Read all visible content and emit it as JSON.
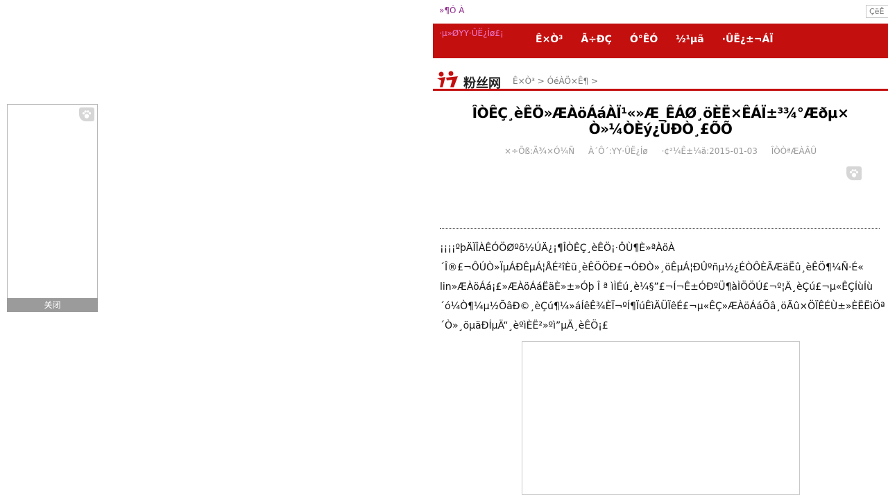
{
  "side_ad": {
    "close_label": "关闭"
  },
  "topbar": {
    "home_link": "»¶Ó À",
    "search_placeholder": "ÇëÊ"
  },
  "navbar": {
    "brand": "·µ»ØYY·ÛË¿Íø£¡",
    "items": [
      {
        "label": "Ê×Ò³"
      },
      {
        "label": "Ã÷ÐÇ"
      },
      {
        "label": "Ó°ÊÓ"
      },
      {
        "label": "½¹µã"
      },
      {
        "label": "·ÛË¿±¬ÁÏ"
      }
    ]
  },
  "logo": {
    "text": "粉丝网"
  },
  "breadcrumb": {
    "home": "Ê×Ò³",
    "sep": ">",
    "section": "ÓéÀÖ×Ê¶"
  },
  "article": {
    "title_line1": "ÎÒÊÇ¸èÊÖ»ÆÀöÁáÀÏ¹«»Æ_ÊÁØ¸öÈË×ÊÁÏ±³¾°Æðµ×",
    "title_line2": "Ò»¼ÒÈý¿ÚÐÒ¸£ÕÕ",
    "meta": {
      "author": "×÷Õß:Ä¾×Ó¼Ñ",
      "source": "À´Ô´:YY·ÛË¿Íø",
      "date": "·¢²¼Ê±¼ä:2015-01-03",
      "views": "ÎÒÒªÆÀÂÛ"
    },
    "body_lines": [
      "¡¡¡¡ºþÄÏÎÀÊÓÖØºõ½ÚÄ¿¡¶ÎÒÊÇ¸èÊÖ¡·ÔÙ¶È»ªÀöÀ",
      "´Î®£¬ÔÚÒ»ÏµÁÐÊµÁ¦ÅÉ²îÈü¸èÊÖÖÐ£¬ÓÐÒ»¸öÊµÁ¦ÐÛºñµ½¿ÉÒÔÈÃÆäËû¸èÊÖ¶¼Ñ·É«",
      "lin»ÆÀöÁá¡£»ÆÀöÁáËäÈ»±»Óþ Î ª ìÌÉú¸è¼§”£¬Í¬Ê±ÓÐºÜ¶àÌÖÖÚ£¬º¦Ä¸èÇú£¬µ«ÊÇÍùÍù",
      "´ó¼Ò¶¼µ½ÕâÐ©¸èÇú¶¼»áÍêÊ¾ÈÏ¬ºÍ¶ÏúÊìÄÜÏêÉ£¬µ«ÊÇ»ÆÀöÁáÕâ¸öÃû×ÖÏÊÉÙ±»ÈËËìÖª",
      "´Ò»¸öµäÐÍµÄ“¸èºìÈË²»ºì”µÄ¸èÊÖ¡£"
    ]
  }
}
